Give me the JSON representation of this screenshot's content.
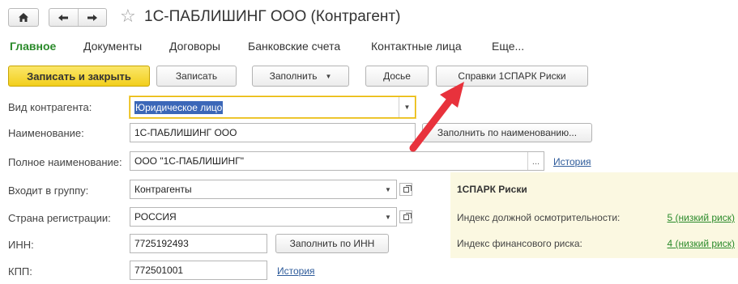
{
  "window": {
    "title": "1С-ПАБЛИШИНГ ООО (Контрагент)"
  },
  "tabs": [
    {
      "label": "Главное",
      "active": true
    },
    {
      "label": "Документы"
    },
    {
      "label": "Договоры"
    },
    {
      "label": "Банковские счета"
    },
    {
      "label": "Контактные лица"
    },
    {
      "label": "Еще..."
    }
  ],
  "toolbar": {
    "save_close": "Записать и закрыть",
    "save": "Записать",
    "fill": "Заполнить",
    "dossier": "Досье",
    "spark_reports": "Справки 1СПАРК Риски"
  },
  "form": {
    "kind": {
      "label": "Вид контрагента:",
      "value": "Юридическое лицо"
    },
    "name": {
      "label": "Наименование:",
      "value": "1С-ПАБЛИШИНГ ООО",
      "fill_button": "Заполнить по наименованию..."
    },
    "full_name": {
      "label": "Полное наименование:",
      "value": "ООО \"1С-ПАБЛИШИНГ\"",
      "history_link": "История"
    },
    "group": {
      "label": "Входит в группу:",
      "value": "Контрагенты"
    },
    "country": {
      "label": "Страна регистрации:",
      "value": "РОССИЯ"
    },
    "inn": {
      "label": "ИНН:",
      "value": "7725192493",
      "fill_button": "Заполнить по ИНН"
    },
    "kpp": {
      "label": "КПП:",
      "value": "772501001",
      "history_link": "История"
    }
  },
  "risk_panel": {
    "title": "1СПАРК Риски",
    "items": [
      {
        "label": "Индекс должной осмотрительности:",
        "value": "5 (низкий риск)"
      },
      {
        "label": "Индекс финансового риска:",
        "value": "4 (низкий риск)"
      }
    ]
  },
  "colors": {
    "accent_green": "#2a8a2a",
    "primary_button": "#f2cf1c",
    "link_blue": "#2f5c9b",
    "arrow_red": "#e8323c",
    "risk_panel_bg": "#fbf8e1"
  },
  "icons": [
    "home-icon",
    "back-arrow-icon",
    "forward-arrow-icon",
    "favorite-star-icon",
    "dropdown-icon",
    "open-form-icon",
    "ellipsis-icon"
  ]
}
